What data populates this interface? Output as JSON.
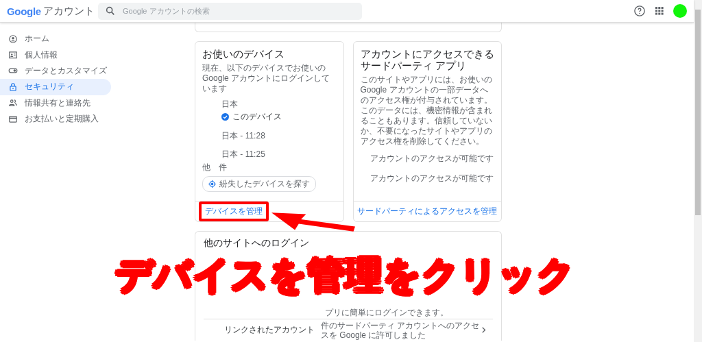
{
  "header": {
    "logo": "Google",
    "product": "アカウント",
    "search": {
      "placeholder": "Google アカウントの検索"
    }
  },
  "sidebar": {
    "items": [
      {
        "label": "ホーム",
        "selected": false
      },
      {
        "label": "個人情報",
        "selected": false
      },
      {
        "label": "データとカスタマイズ",
        "selected": false
      },
      {
        "label": "セキュリティ",
        "selected": true
      },
      {
        "label": "情報共有と連絡先",
        "selected": false
      },
      {
        "label": "お支払いと定期購入",
        "selected": false
      }
    ]
  },
  "device_card": {
    "title": "お使いのデバイス",
    "description": "現在、以下のデバイスでお使いの Google アカウントにログインしています",
    "devices": [
      {
        "name": "日本",
        "current": true,
        "current_label": "このデバイス"
      },
      {
        "name": "日本 - 11:28",
        "current": false
      },
      {
        "name": "日本 - 11:25",
        "current": false
      }
    ],
    "more": "他　件",
    "find_button": "紛失したデバイスを探す",
    "manage_link": {
      "label": "デバイスを管理",
      "highlighted": true
    }
  },
  "third_party_card": {
    "title": "アカウントにアクセスできるサードパーティ アプリ",
    "description": "このサイトやアプリには、お使いの Google アカウントの一部データへのアクセス権が付与されています。このデータには、機密情報が含まれることもあります。信頼していないか、不要になったサイトやアプリのアクセス権を削除してください。",
    "apps": [
      "アカウントのアクセスが可能です",
      "アカウントのアクセスが可能です"
    ],
    "manage_link": "サードパーティによるアクセスを管理"
  },
  "signin_card": {
    "title": "他のサイトへのログイン",
    "rows": [
      {
        "description": "プリに簡単にログインできます。"
      },
      {
        "label": "リンクされたアカウント",
        "description": "件のサードパーティ アカウントへのアクセスを Google に許可しました"
      }
    ]
  },
  "annotation": {
    "caption": "デバイスを管理をクリック"
  }
}
